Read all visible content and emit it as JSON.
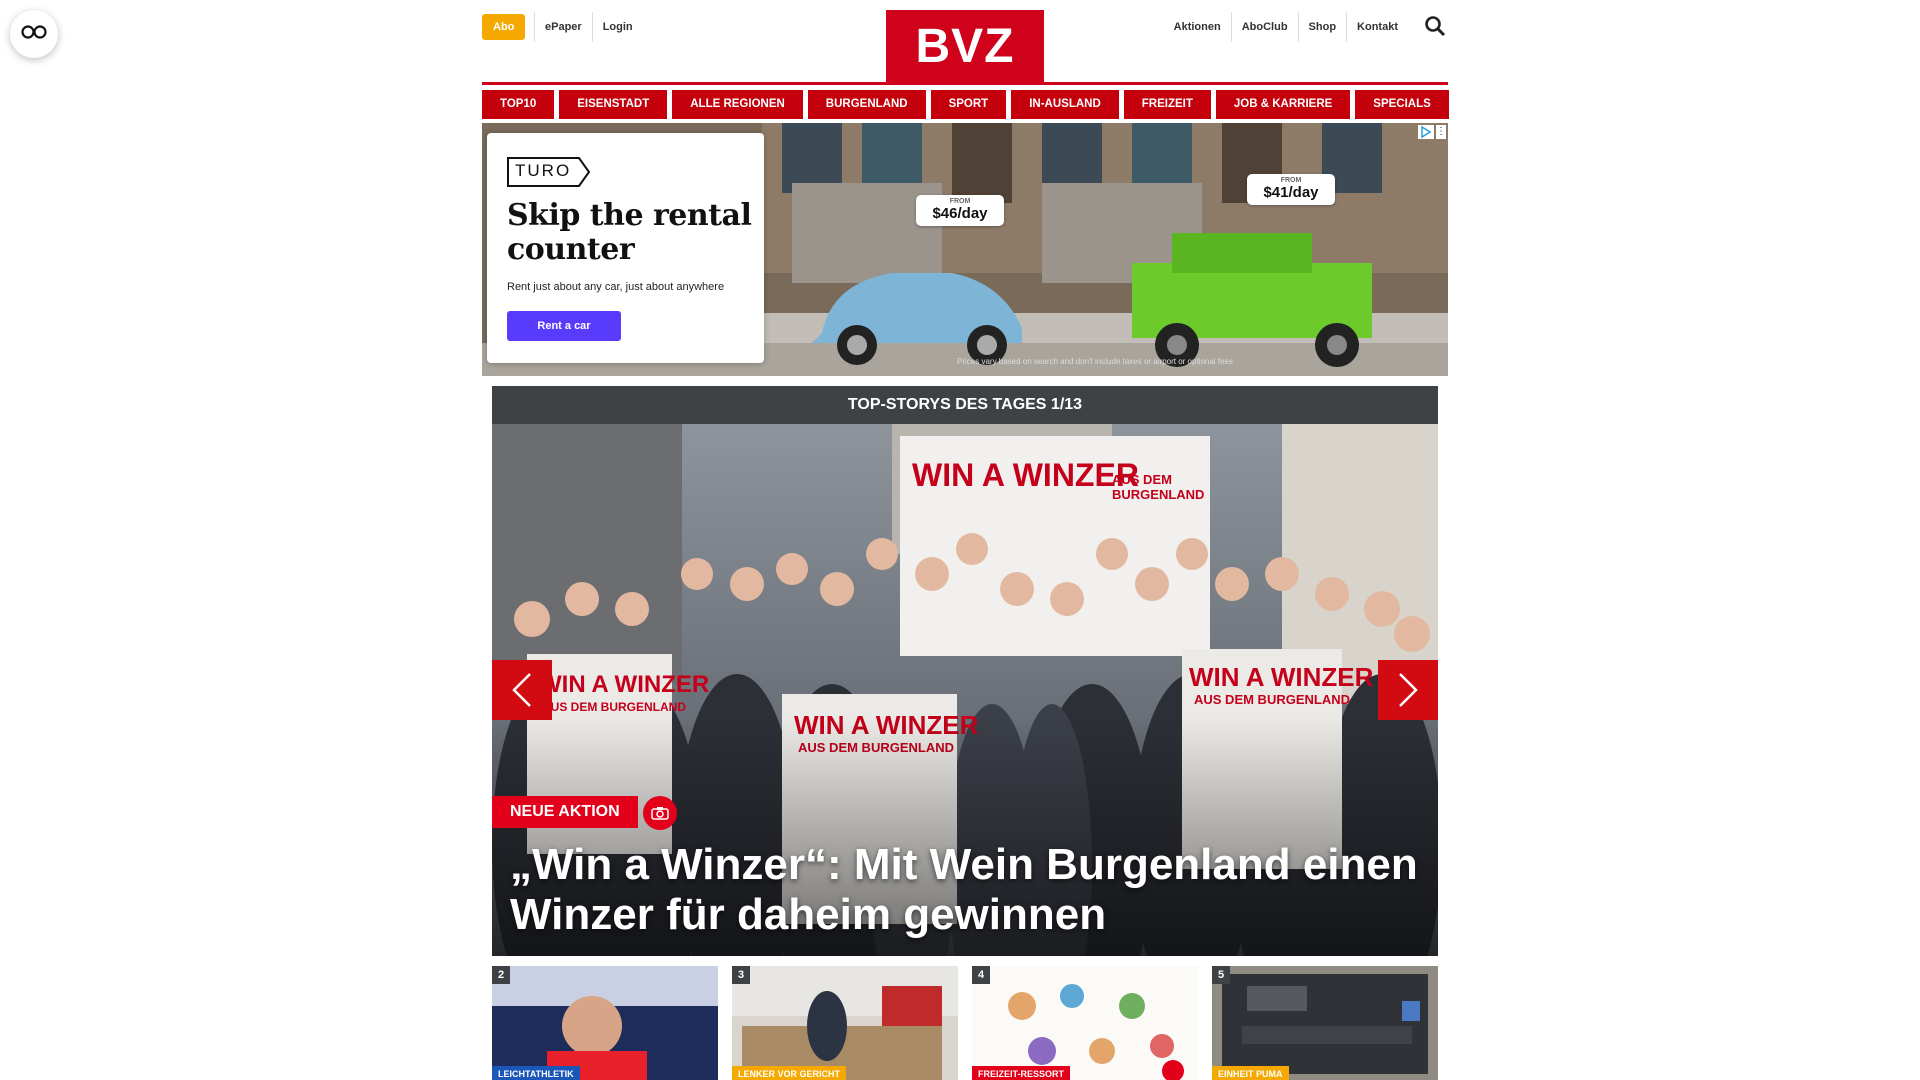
{
  "colors": {
    "brand_red": "#d0021b",
    "nav_red": "#c4000c",
    "abo_yellow": "#f5a800",
    "ad_cta": "#593cfb",
    "header_dark": "#3e4245"
  },
  "accessibility": {
    "icon": "accessibility-glasses-icon"
  },
  "header": {
    "abo_label": "Abo",
    "left_links": [
      "ePaper",
      "Login"
    ],
    "logo_text": "BVZ",
    "right_links": [
      "Aktionen",
      "AboClub",
      "Shop",
      "Kontakt"
    ],
    "search_icon": "search-icon"
  },
  "nav": {
    "items": [
      "TOP10",
      "EISENSTADT",
      "ALLE REGIONEN",
      "BURGENLAND",
      "SPORT",
      "IN-AUSLAND",
      "FREIZEIT",
      "JOB & KARRIERE",
      "SPECIALS"
    ]
  },
  "ad": {
    "brand": "TURO",
    "headline": "Skip the rental counter",
    "subtext": "Rent just about any car, just about anywhere",
    "cta": "Rent a car",
    "price_1_from": "FROM",
    "price_1": "$46/day",
    "price_2_from": "FROM",
    "price_2": "$41/day",
    "disclaimer": "Prices vary based on search and don't include taxes or airport or optional fees"
  },
  "top_stories": {
    "header": "TOP-STORYS DES TAGES 1/13",
    "hero": {
      "kicker": "NEUE AKTION",
      "title": "„Win a Winzer“: Mit Wein Burgenland einen Winzer für daheim gewinnen",
      "banner_text": "WIN A WINZER",
      "banner_sub": "AUS DEM BURGENLAND"
    },
    "teasers": [
      {
        "number": "2",
        "category": "LEICHTATHLETIK",
        "cat_color": "#1a57b8"
      },
      {
        "number": "3",
        "category": "LENKER VOR GERICHT",
        "cat_color": "#f5a800"
      },
      {
        "number": "4",
        "category": "FREIZEIT-RESSORT",
        "cat_color": "#e3001b"
      },
      {
        "number": "5",
        "category": "EINHEIT PUMA",
        "cat_color": "#f5a800"
      }
    ]
  }
}
